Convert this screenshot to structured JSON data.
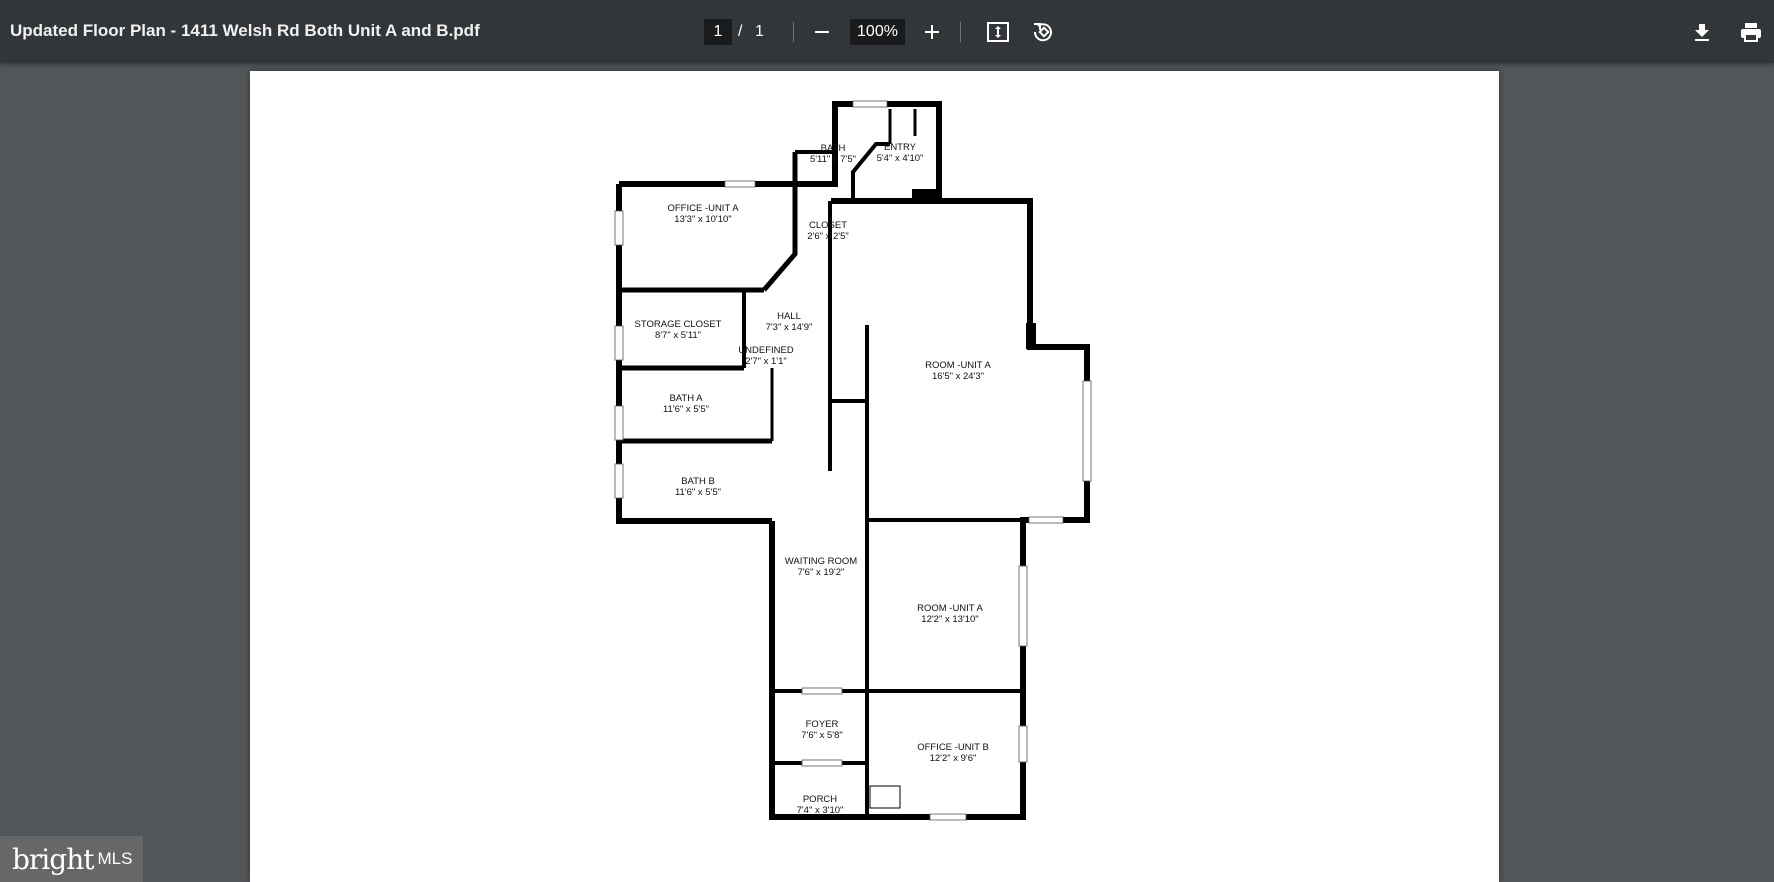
{
  "toolbar": {
    "title": "Updated Floor Plan - 1411 Welsh Rd Both Unit A and B.pdf",
    "current_page": "1",
    "page_separator": "/",
    "total_pages": "1",
    "zoom": "100%",
    "icons": [
      "minus-icon",
      "plus-icon",
      "fit-page-icon",
      "rotate-icon",
      "download-icon",
      "print-icon"
    ]
  },
  "floorplan": {
    "rooms": [
      {
        "name": "BATH",
        "dims": "5'11\" x 7'5\""
      },
      {
        "name": "ENTRY",
        "dims": "5'4\" x 4'10\""
      },
      {
        "name": "OFFICE -UNIT A",
        "dims": "13'3\" x 10'10\""
      },
      {
        "name": "CLOSET",
        "dims": "2'6\" x 2'5\""
      },
      {
        "name": "HALL",
        "dims": "7'3\" x 14'9\""
      },
      {
        "name": "STORAGE CLOSET",
        "dims": "8'7\" x 5'11\""
      },
      {
        "name": "UNDEFINED",
        "dims": "2'7\" x 1'1\""
      },
      {
        "name": "ROOM -UNIT A",
        "dims": "16'5\" x 24'3\""
      },
      {
        "name": "BATH A",
        "dims": "11'6\" x 5'5\""
      },
      {
        "name": "BATH B",
        "dims": "11'6\" x 5'5\""
      },
      {
        "name": "WAITING ROOM",
        "dims": "7'6\" x 19'2\""
      },
      {
        "name": "ROOM -UNIT A",
        "dims": "12'2\" x 13'10\""
      },
      {
        "name": "FOYER",
        "dims": "7'6\" x 5'8\""
      },
      {
        "name": "OFFICE -UNIT B",
        "dims": "12'2\" x 9'6\""
      },
      {
        "name": "PORCH",
        "dims": "7'4\" x 3'10\""
      }
    ]
  },
  "watermark": {
    "brand": "bright",
    "suffix": "MLS"
  }
}
